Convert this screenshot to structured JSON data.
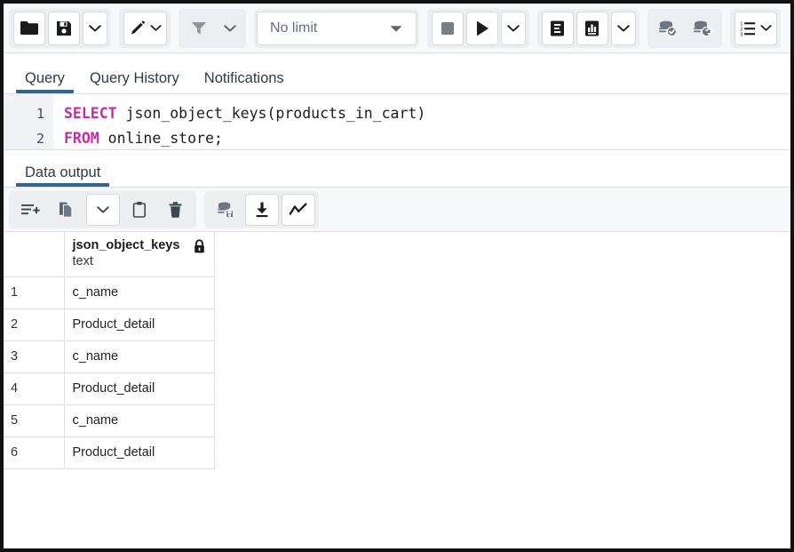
{
  "toolbar": {
    "groups": [
      {
        "name": "file-group",
        "buttons": [
          {
            "name": "open-file-button",
            "icon": "folder-icon",
            "title": "Open File",
            "disabled": false
          },
          {
            "name": "save-file-button",
            "icon": "save-icon",
            "title": "Save File",
            "disabled": false
          },
          {
            "name": "save-file-dropdown",
            "icon": "chevron-down-icon",
            "title": "Save options",
            "disabled": false
          }
        ]
      },
      {
        "name": "edit-group",
        "buttons": [
          {
            "name": "edit-button",
            "icon": "pencil-icon",
            "title": "Edit",
            "disabled": false
          },
          {
            "name": "edit-dropdown",
            "icon": "chevron-down-icon",
            "title": "Edit options",
            "disabled": false
          }
        ]
      },
      {
        "name": "filter-group",
        "buttons": [
          {
            "name": "filter-button",
            "icon": "filter-icon",
            "title": "Filter",
            "disabled": true
          },
          {
            "name": "filter-dropdown",
            "icon": "chevron-down-icon",
            "title": "Filter options",
            "disabled": true
          }
        ]
      }
    ],
    "row_limit": {
      "name": "row-limit-select",
      "value": "No limit",
      "icon": "chevron-down-icon"
    },
    "execute_group": [
      {
        "name": "stop-query-button",
        "icon": "stop-square-icon",
        "title": "Stop",
        "disabled": true
      },
      {
        "name": "execute-query-button",
        "icon": "play-icon",
        "title": "Execute/Refresh",
        "disabled": false
      },
      {
        "name": "execute-dropdown",
        "icon": "chevron-down-icon",
        "title": "Execute options",
        "disabled": false
      }
    ],
    "explain_group": [
      {
        "name": "explain-button",
        "icon": "explain-e-icon",
        "title": "Explain",
        "disabled": false
      },
      {
        "name": "explain-analyze-button",
        "icon": "explain-analyze-chart-icon",
        "title": "Explain Analyze",
        "disabled": false
      },
      {
        "name": "explain-dropdown",
        "icon": "chevron-down-icon",
        "title": "Explain options",
        "disabled": false
      }
    ],
    "transaction_group": [
      {
        "name": "commit-button",
        "icon": "database-check-icon",
        "title": "Commit",
        "disabled": true
      },
      {
        "name": "rollback-button",
        "icon": "database-undo-icon",
        "title": "Rollback",
        "disabled": true
      }
    ],
    "macros_group": [
      {
        "name": "macros-button",
        "icon": "ordered-list-icon",
        "title": "Macros",
        "disabled": false
      },
      {
        "name": "macros-caret",
        "icon": "chevron-down-icon",
        "title": "Macros options",
        "disabled": false
      }
    ]
  },
  "tabs": [
    {
      "name": "tab-query",
      "label": "Query",
      "active": true
    },
    {
      "name": "tab-query-history",
      "label": "Query History",
      "active": false
    },
    {
      "name": "tab-notifications",
      "label": "Notifications",
      "active": false
    }
  ],
  "editor": {
    "lines": [
      {
        "number": "1",
        "keyword": "SELECT",
        "rest": " json_object_keys(products_in_cart)"
      },
      {
        "number": "2",
        "keyword": "FROM",
        "rest": " online_store;"
      }
    ]
  },
  "output": {
    "tabs": [
      {
        "name": "tab-data-output",
        "label": "Data output",
        "active": true
      }
    ],
    "toolbar": [
      {
        "name": "add-row-button",
        "icon": "add-row-icon",
        "title": "Add row",
        "disabled": false
      },
      {
        "name": "copy-button",
        "icon": "copy-icon",
        "title": "Copy",
        "disabled": false
      },
      {
        "name": "copy-dropdown",
        "icon": "chevron-down-icon",
        "title": "Copy options",
        "disabled": false
      },
      {
        "name": "paste-button",
        "icon": "paste-clipboard-icon",
        "title": "Paste",
        "disabled": false
      },
      {
        "name": "delete-row-button",
        "icon": "trash-icon",
        "title": "Delete row",
        "disabled": false
      },
      {
        "name": "save-data-changes-button",
        "icon": "database-save-icon",
        "title": "Save Data Changes",
        "disabled": true
      },
      {
        "name": "download-results-button",
        "icon": "download-icon",
        "title": "Download as CSV",
        "disabled": false
      },
      {
        "name": "graph-visualiser-button",
        "icon": "line-chart-icon",
        "title": "Graph Visualiser",
        "disabled": false
      }
    ],
    "grid": {
      "row_header": "",
      "columns": [
        {
          "name": "json_object_keys",
          "type": "text",
          "lock_icon": "lock-icon"
        }
      ],
      "rows": [
        {
          "num": "1",
          "json_object_keys": "c_name"
        },
        {
          "num": "2",
          "json_object_keys": "Product_detail"
        },
        {
          "num": "3",
          "json_object_keys": "c_name"
        },
        {
          "num": "4",
          "json_object_keys": "Product_detail"
        },
        {
          "num": "5",
          "json_object_keys": "c_name"
        },
        {
          "num": "6",
          "json_object_keys": "Product_detail"
        }
      ]
    }
  },
  "colors": {
    "accent": "#326690",
    "keyword": "#c42ba8",
    "toolbar_bg": "#f7f8fa",
    "border": "#dcdfe3",
    "disabled_icon": "#9aa3ad",
    "active_icon": "#1c1c1c"
  }
}
